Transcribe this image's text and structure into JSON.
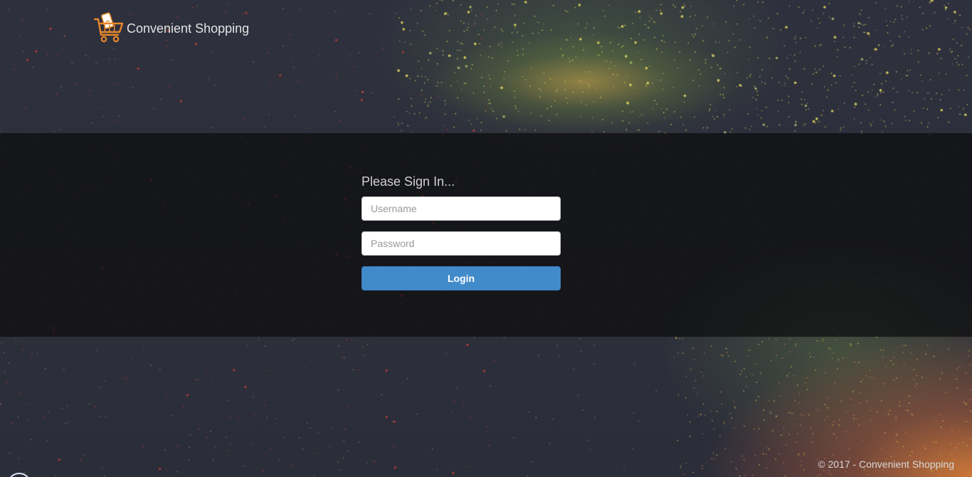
{
  "brand": {
    "name": "Convenient Shopping",
    "icon": "shopping-cart-phone-icon",
    "accent_color": "#e8872b"
  },
  "login": {
    "title": "Please Sign In...",
    "username_placeholder": "Username",
    "username_value": "",
    "password_placeholder": "Password",
    "password_value": "",
    "button_label": "Login",
    "button_color": "#428bca"
  },
  "footer": {
    "text": "© 2017 - Convenient Shopping"
  },
  "colors": {
    "background": "#2d2f3b",
    "band": "#141416"
  }
}
